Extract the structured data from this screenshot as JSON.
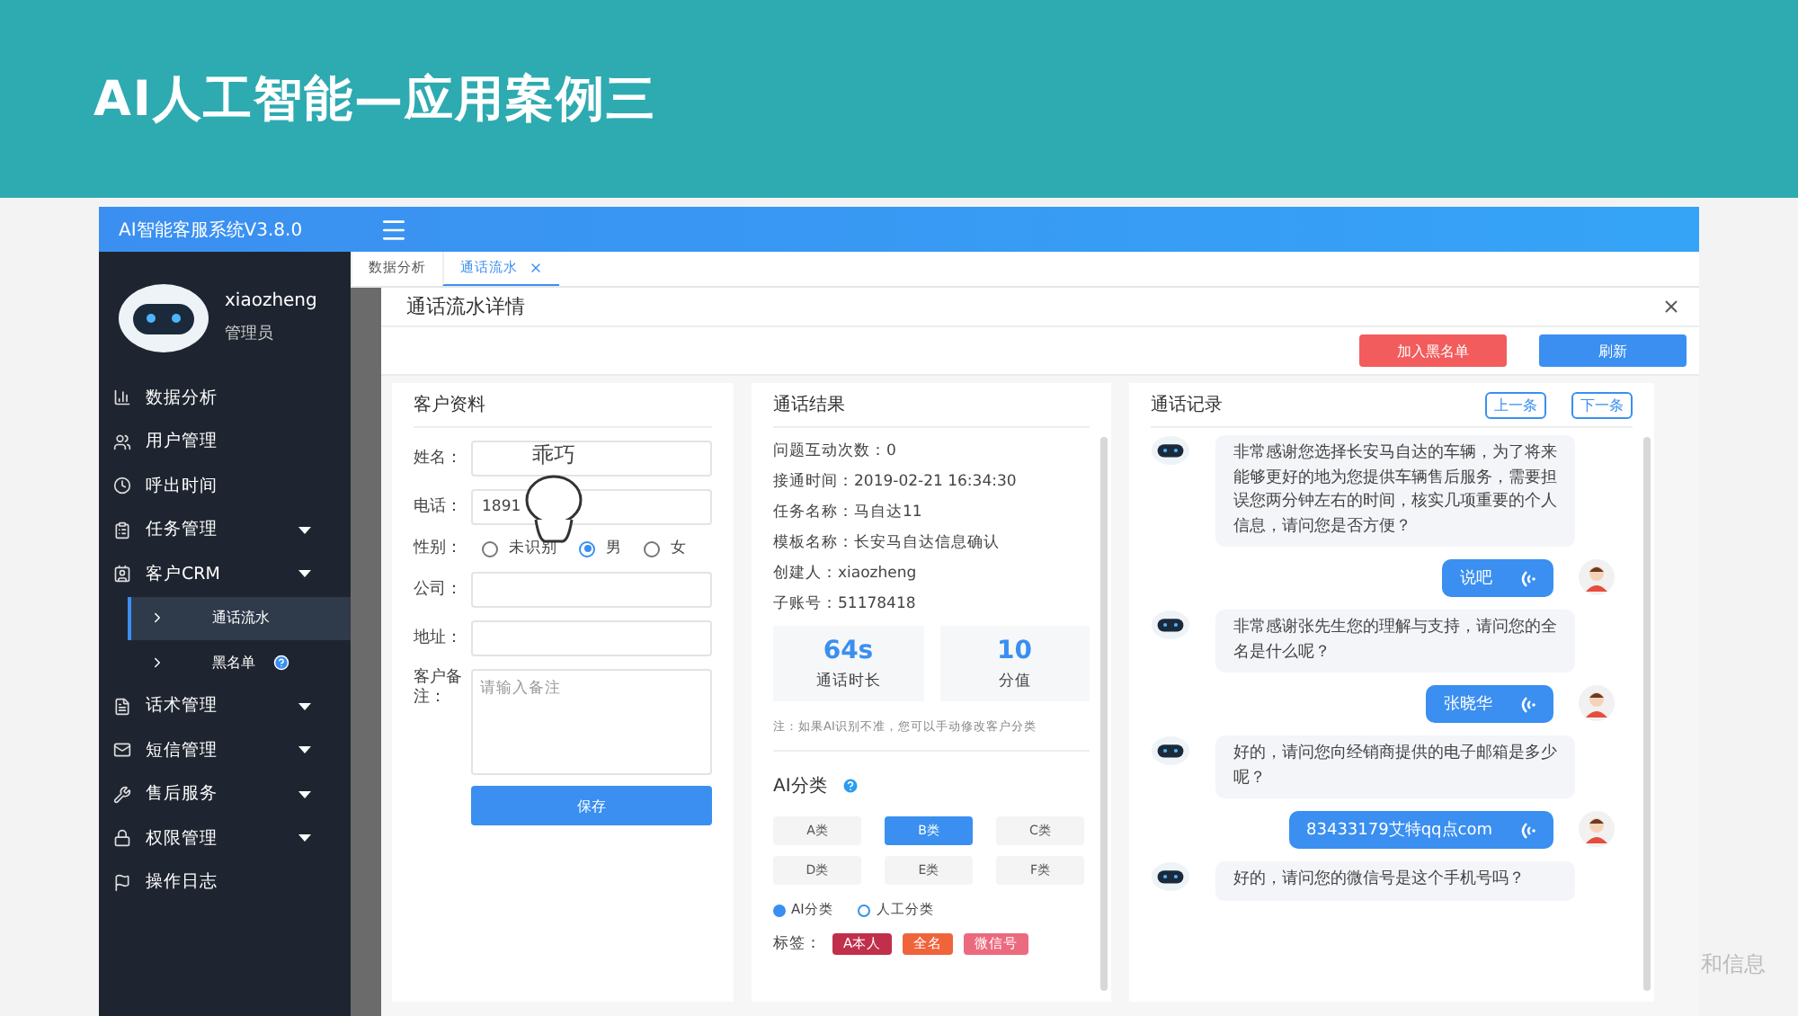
{
  "slide_title": "AI人工智能—应用案例三",
  "app": {
    "title": "AI智能客服系统V3.8.0"
  },
  "user": {
    "name": "xiaozheng",
    "role": "管理员"
  },
  "sidebar": {
    "items": [
      {
        "label": "数据分析",
        "expandable": false
      },
      {
        "label": "用户管理",
        "expandable": false
      },
      {
        "label": "呼出时间",
        "expandable": false
      },
      {
        "label": "任务管理",
        "expandable": true
      },
      {
        "label": "客户CRM",
        "expandable": true,
        "children": [
          {
            "label": "通话流水",
            "selected": true,
            "help": false
          },
          {
            "label": "黑名单",
            "selected": false,
            "help": true
          }
        ]
      },
      {
        "label": "话术管理",
        "expandable": true
      },
      {
        "label": "短信管理",
        "expandable": true
      },
      {
        "label": "售后服务",
        "expandable": true
      },
      {
        "label": "权限管理",
        "expandable": true
      },
      {
        "label": "操作日志",
        "expandable": false
      }
    ]
  },
  "tabs": [
    {
      "label": "数据分析",
      "selected": false,
      "closable": false
    },
    {
      "label": "通话流水",
      "selected": true,
      "closable": true
    }
  ],
  "dialog": {
    "title": "通话流水详情",
    "buttons": [
      {
        "label": "加入黑名单",
        "kind": "danger"
      },
      {
        "label": "刷新",
        "kind": "primary"
      }
    ]
  },
  "customer": {
    "title": "客户资料",
    "fields": [
      {
        "kind": "input",
        "label": "姓名："
      },
      {
        "kind": "input",
        "label": "电话：",
        "value": "1891"
      },
      {
        "kind": "radio",
        "label": "性别：",
        "options": [
          {
            "label": "未识别",
            "selected": false
          },
          {
            "label": "男",
            "selected": true
          },
          {
            "label": "女",
            "selected": false
          }
        ]
      },
      {
        "kind": "input",
        "label": "公司："
      },
      {
        "kind": "input",
        "label": "地址："
      },
      {
        "kind": "textarea",
        "label": "客户备注：",
        "placeholder": "请输入备注"
      }
    ],
    "save": "保存",
    "sticker": {
      "text": "乖巧"
    }
  },
  "result": {
    "title": "通话结果",
    "lines": [
      "问题互动次数：0",
      "接通时间：2019-02-21 16:34:30",
      "任务名称：马自达11",
      "模板名称：长安马自达信息确认",
      "创建人：xiaozheng",
      "子账号：51178418"
    ],
    "stats": [
      {
        "value": "64s",
        "label": "通话时长"
      },
      {
        "value": "10",
        "label": "分值"
      }
    ],
    "note": "注：如果AI识别不准，您可以手动修改客户分类",
    "classify_title": "AI分类",
    "classes": [
      {
        "label": "A类",
        "selected": false
      },
      {
        "label": "B类",
        "selected": true
      },
      {
        "label": "C类",
        "selected": false
      },
      {
        "label": "D类",
        "selected": false
      },
      {
        "label": "E类",
        "selected": false
      },
      {
        "label": "F类",
        "selected": false
      }
    ],
    "modes": [
      {
        "label": "AI分类",
        "selected": true
      },
      {
        "label": "人工分类",
        "selected": false
      }
    ],
    "tags_label": "标签：",
    "tags": [
      {
        "label": "A本人",
        "color": "#c0304a"
      },
      {
        "label": "全名",
        "color": "#f0643c"
      },
      {
        "label": "微信号",
        "color": "#ec6a7e"
      }
    ]
  },
  "chat": {
    "title": "通话记录",
    "nav": [
      "上一条",
      "下一条"
    ],
    "messages": [
      {
        "kind": "bot",
        "text": "非常感谢您选择长安马自达的车辆，为了将来能够更好的地为您提供车辆售后服务，需要担误您两分钟左右的时间，核实几项重要的个人信息，请问您是否方便？"
      },
      {
        "kind": "user",
        "text": "说吧"
      },
      {
        "kind": "bot",
        "text": "非常感谢张先生您的理解与支持，请问您的全名是什么呢？"
      },
      {
        "kind": "user",
        "text": "张晓华"
      },
      {
        "kind": "bot",
        "text": "好的，请问您向经销商提供的电子邮箱是多少呢？"
      },
      {
        "kind": "user",
        "text": "83433179艾特qq点com"
      },
      {
        "kind": "bot",
        "text": "好的，请问您的微信号是这个手机号吗？"
      }
    ]
  },
  "background_caption": "和信息"
}
